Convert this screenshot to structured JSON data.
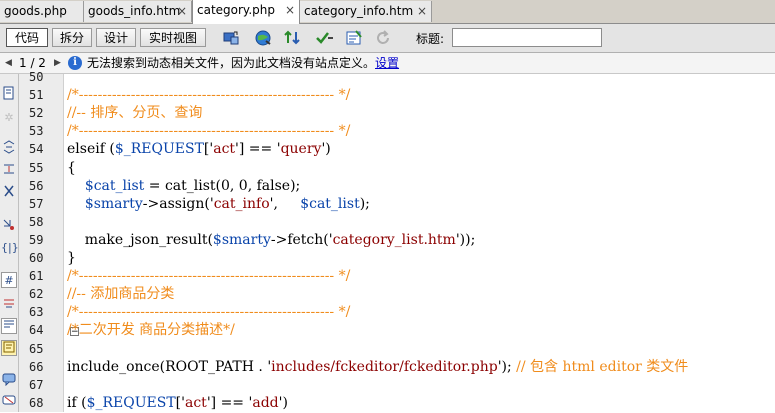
{
  "tabs": [
    {
      "label": "goods.php",
      "close": ""
    },
    {
      "label": "goods_info.htm",
      "close": "×"
    },
    {
      "label": "category.php",
      "close": "×"
    },
    {
      "label": "category_info.htm",
      "close": "×"
    }
  ],
  "toolbar": {
    "views": [
      "代码",
      "拆分",
      "设计",
      "实时视图"
    ],
    "title_label": "标题:",
    "title_value": ""
  },
  "infobar": {
    "page": "1 / 2",
    "message": "无法搜索到动态相关文件，因为此文档没有站点定义。",
    "link": "设置"
  },
  "editor": {
    "lines": [
      {
        "n": "50",
        "parts": [
          {
            "t": "",
            "c": ""
          }
        ]
      },
      {
        "n": "51",
        "parts": [
          {
            "t": "/*------------------------------------------------------ */",
            "c": "cm"
          }
        ]
      },
      {
        "n": "52",
        "parts": [
          {
            "t": "//-- 排序、分页、查询",
            "c": "cm"
          }
        ]
      },
      {
        "n": "53",
        "parts": [
          {
            "t": "/*------------------------------------------------------ */",
            "c": "cm"
          }
        ]
      },
      {
        "n": "54",
        "parts": [
          {
            "t": "elseif (",
            "c": ""
          },
          {
            "t": "$_REQUEST",
            "c": "vr"
          },
          {
            "t": "['",
            "c": ""
          },
          {
            "t": "act",
            "c": "st"
          },
          {
            "t": "'] == '",
            "c": ""
          },
          {
            "t": "query",
            "c": "st"
          },
          {
            "t": "')",
            "c": ""
          }
        ]
      },
      {
        "n": "55",
        "parts": [
          {
            "t": "{",
            "c": ""
          }
        ]
      },
      {
        "n": "56",
        "parts": [
          {
            "t": "    ",
            "c": ""
          },
          {
            "t": "$cat_list",
            "c": "vr"
          },
          {
            "t": " = cat_list(0, 0, false);",
            "c": ""
          }
        ]
      },
      {
        "n": "57",
        "parts": [
          {
            "t": "    ",
            "c": ""
          },
          {
            "t": "$smarty",
            "c": "vr"
          },
          {
            "t": "->assign('",
            "c": ""
          },
          {
            "t": "cat_info",
            "c": "st"
          },
          {
            "t": "',     ",
            "c": ""
          },
          {
            "t": "$cat_list",
            "c": "vr"
          },
          {
            "t": ");",
            "c": ""
          }
        ]
      },
      {
        "n": "58",
        "parts": [
          {
            "t": "",
            "c": ""
          }
        ]
      },
      {
        "n": "59",
        "parts": [
          {
            "t": "    make_json_result(",
            "c": ""
          },
          {
            "t": "$smarty",
            "c": "vr"
          },
          {
            "t": "->fetch('",
            "c": ""
          },
          {
            "t": "category_list.htm",
            "c": "st"
          },
          {
            "t": "'));",
            "c": ""
          }
        ]
      },
      {
        "n": "60",
        "parts": [
          {
            "t": "}",
            "c": ""
          }
        ]
      },
      {
        "n": "61",
        "parts": [
          {
            "t": "/*------------------------------------------------------ */",
            "c": "cm"
          }
        ]
      },
      {
        "n": "62",
        "parts": [
          {
            "t": "//-- 添加商品分类",
            "c": "cm"
          }
        ]
      },
      {
        "n": "63",
        "parts": [
          {
            "t": "/*------------------------------------------------------ */",
            "c": "cm"
          }
        ]
      },
      {
        "n": "64",
        "parts": [
          {
            "t": "/*二次开发 商品分类描述*/",
            "c": "cm"
          }
        ]
      },
      {
        "n": "65",
        "parts": [
          {
            "t": "",
            "c": ""
          }
        ]
      },
      {
        "n": "66",
        "parts": [
          {
            "t": "include_once(ROOT_PATH . '",
            "c": ""
          },
          {
            "t": "includes/fckeditor/fckeditor.php",
            "c": "st"
          },
          {
            "t": "'); ",
            "c": ""
          },
          {
            "t": "// 包含 html editor 类文件",
            "c": "cm"
          }
        ]
      },
      {
        "n": "67",
        "parts": [
          {
            "t": "",
            "c": ""
          }
        ]
      },
      {
        "n": "68",
        "parts": [
          {
            "t": "if (",
            "c": ""
          },
          {
            "t": "$_REQUEST",
            "c": "vr"
          },
          {
            "t": "['",
            "c": ""
          },
          {
            "t": "act",
            "c": "st"
          },
          {
            "t": "'] == '",
            "c": ""
          },
          {
            "t": "add",
            "c": "st"
          },
          {
            "t": "')",
            "c": ""
          }
        ]
      }
    ]
  }
}
